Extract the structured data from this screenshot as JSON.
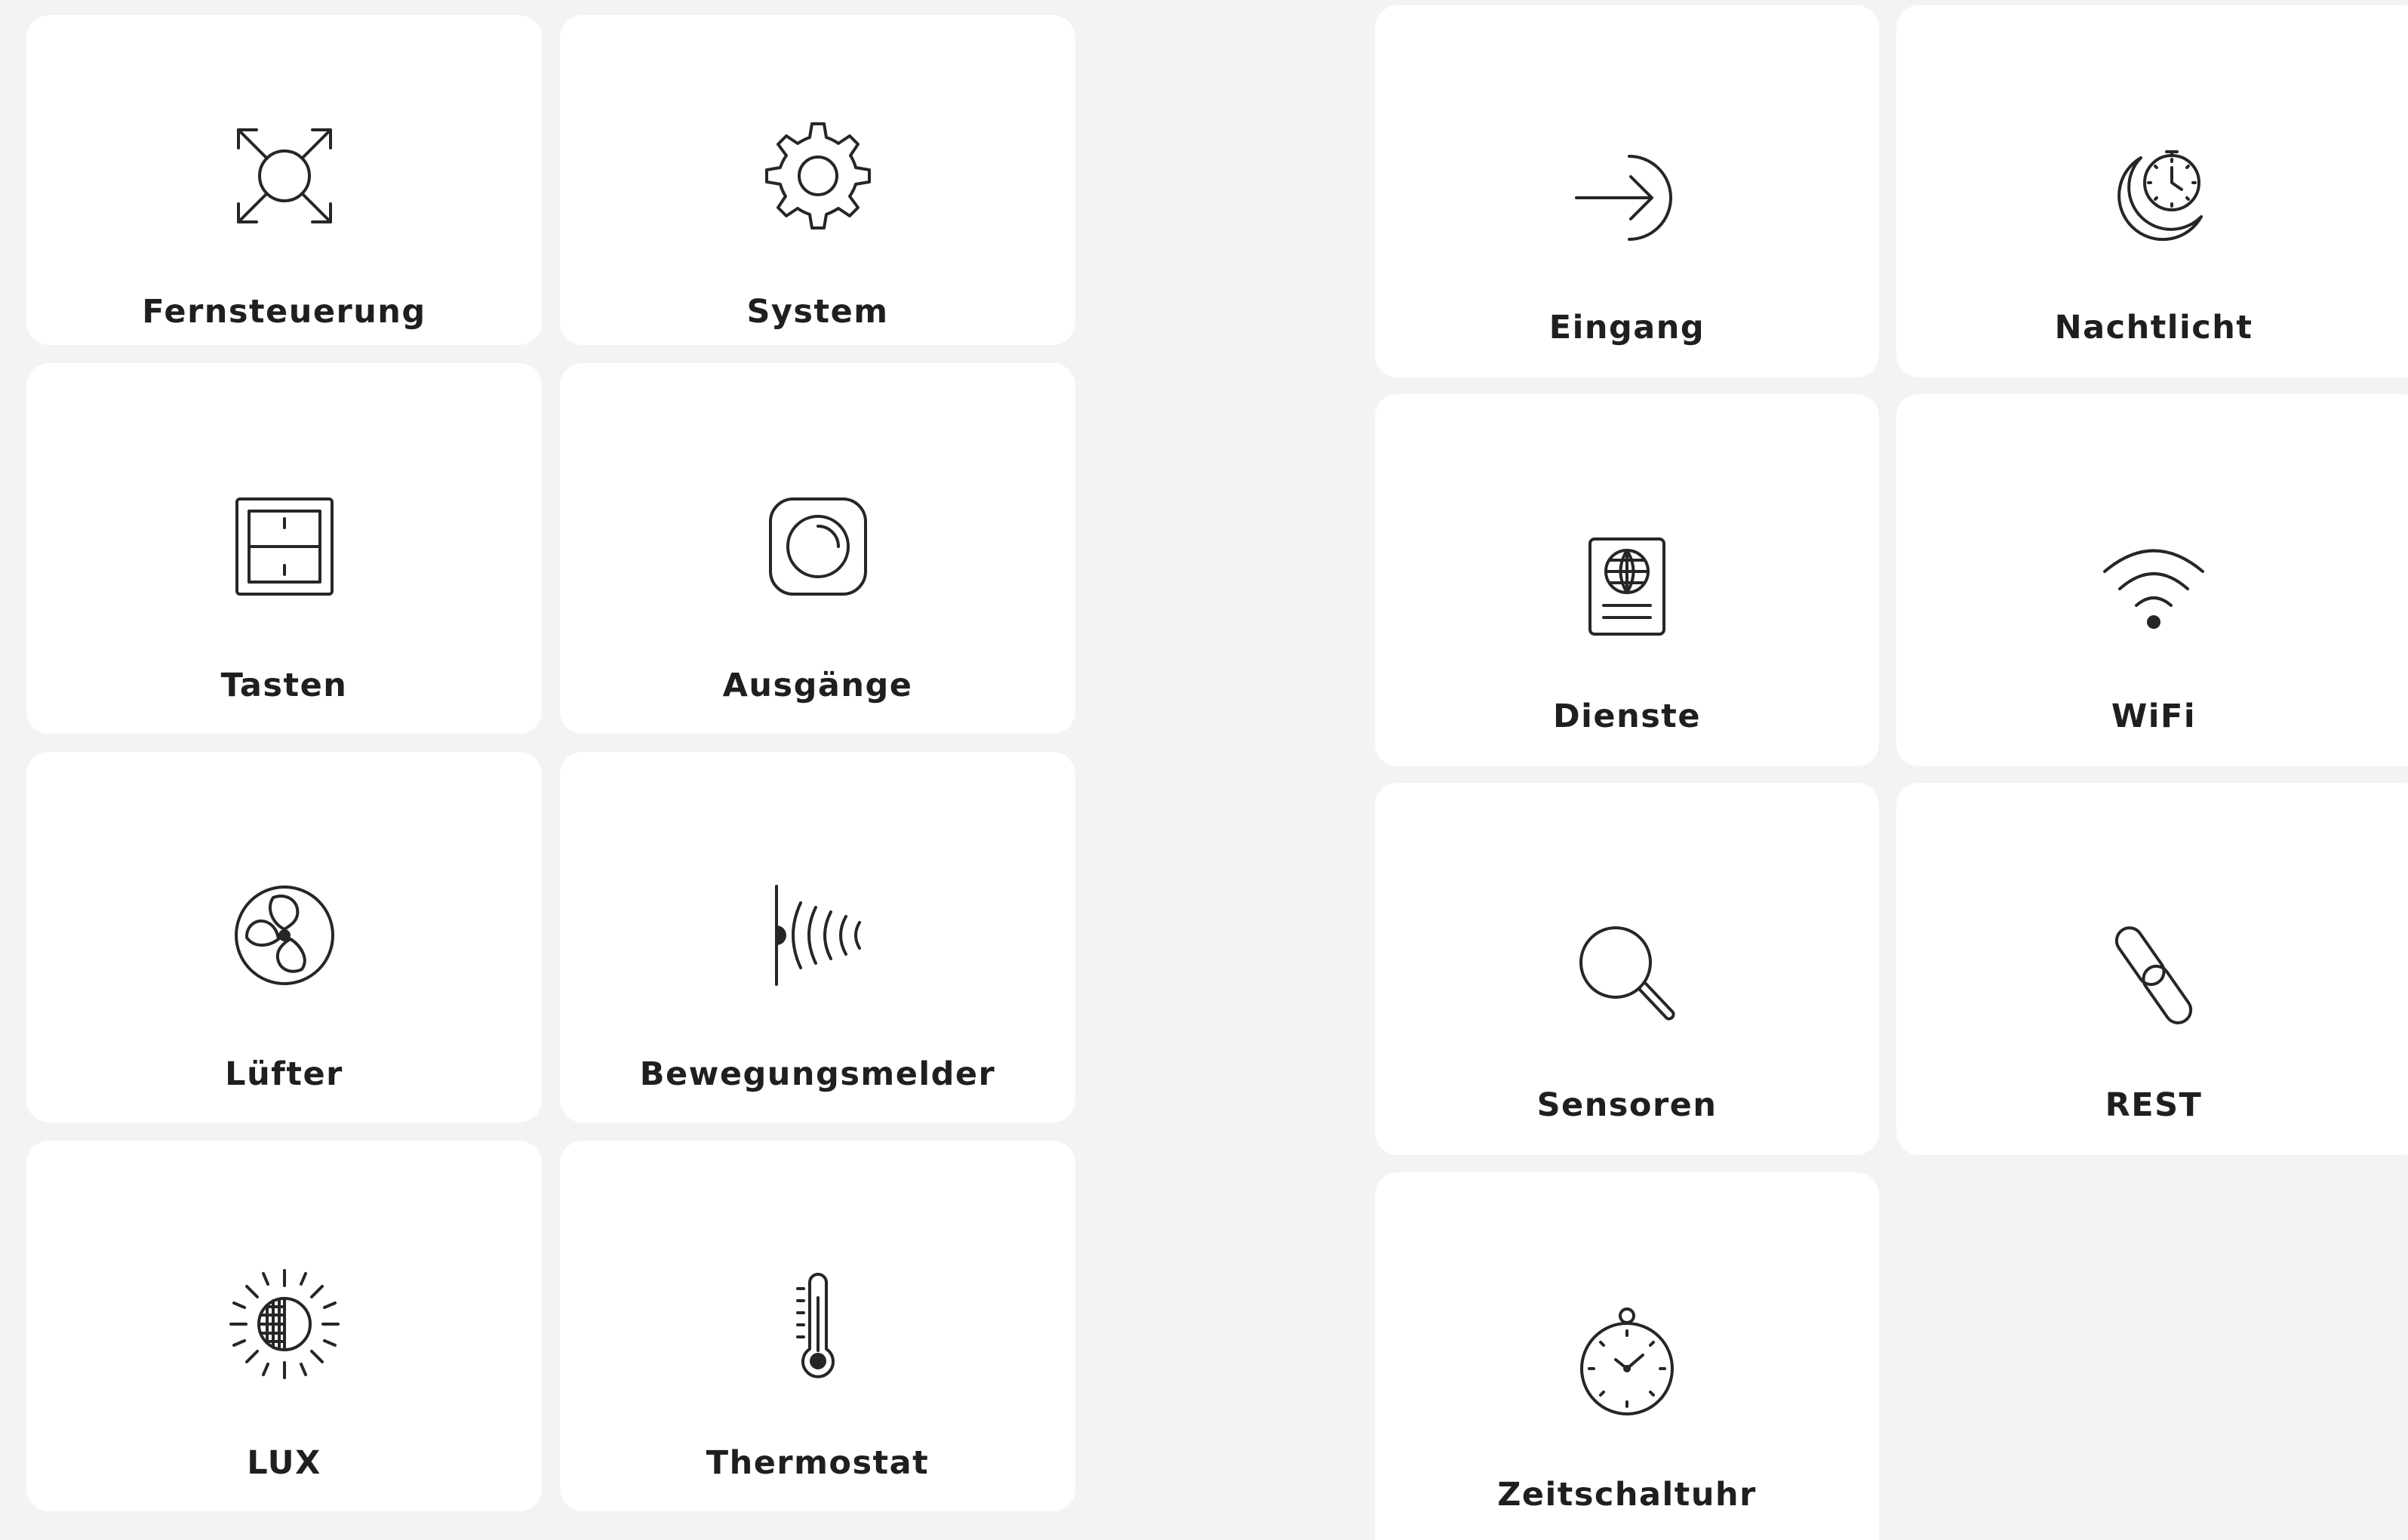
{
  "tiles": [
    {
      "label": "Fernsteuerung",
      "icon": "remote-control-icon"
    },
    {
      "label": "System",
      "icon": "gear-icon"
    },
    {
      "label": "Tasten",
      "icon": "switch-panel-icon"
    },
    {
      "label": "Ausgänge",
      "icon": "dial-knob-icon"
    },
    {
      "label": "Lüfter",
      "icon": "fan-icon"
    },
    {
      "label": "Bewegungsmelder",
      "icon": "motion-sensor-icon"
    },
    {
      "label": "LUX",
      "icon": "brightness-icon"
    },
    {
      "label": "Thermostat",
      "icon": "thermometer-icon"
    },
    {
      "label": "Eingang",
      "icon": "login-icon"
    },
    {
      "label": "Nachtlicht",
      "icon": "moon-clock-icon"
    },
    {
      "label": "Dienste",
      "icon": "passport-icon"
    },
    {
      "label": "WiFi",
      "icon": "wifi-icon"
    },
    {
      "label": "Sensoren",
      "icon": "magnifier-icon"
    },
    {
      "label": "REST",
      "icon": "link-icon"
    },
    {
      "label": "Zeitschaltuhr",
      "icon": "stopwatch-icon"
    }
  ],
  "colors": {
    "background": "#f3f3f3",
    "tile": "#ffffff",
    "ink": "#262626"
  }
}
